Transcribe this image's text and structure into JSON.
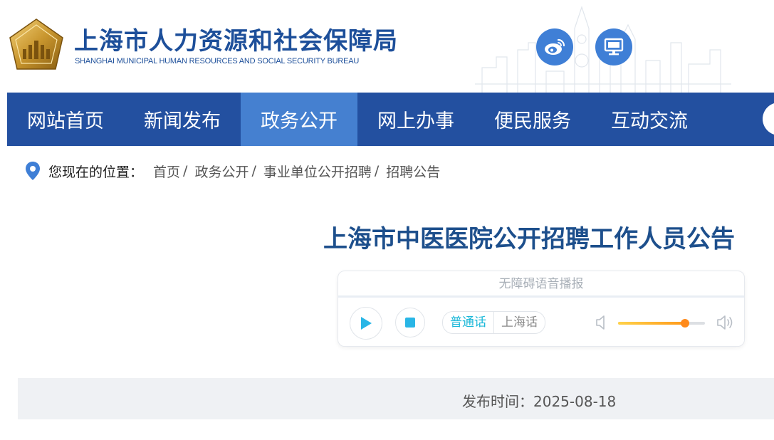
{
  "header": {
    "title_cn": "上海市人力资源和社会保障局",
    "title_en": "SHANGHAI MUNICIPAL HUMAN RESOURCES AND SOCIAL SECURITY BUREAU",
    "emblem_text": "上海市人力资源和社会保障局",
    "brand_color": "#1d4f9a",
    "icons": [
      "weibo-icon",
      "desktop-icon"
    ]
  },
  "nav": {
    "items": [
      "网站首页",
      "新闻发布",
      "政务公开",
      "网上办事",
      "便民服务",
      "互动交流"
    ],
    "active_index": 2,
    "bg_color": "#2350a0",
    "active_color": "#4580d0"
  },
  "breadcrumb": {
    "label": "您现在的位置：",
    "items": [
      "首页",
      "政务公开",
      "事业单位公开招聘",
      "招聘公告"
    ],
    "separator": "/"
  },
  "article": {
    "title": "上海市中医医院公开招聘工作人员公告",
    "publish_label": "发布时间：",
    "publish_date": "2025-08-18"
  },
  "player": {
    "title": "无障碍语音播报",
    "languages": [
      "普通话",
      "上海话"
    ],
    "active_language": "普通话",
    "volume": 0.77,
    "accent_color": "#19b7d8"
  }
}
